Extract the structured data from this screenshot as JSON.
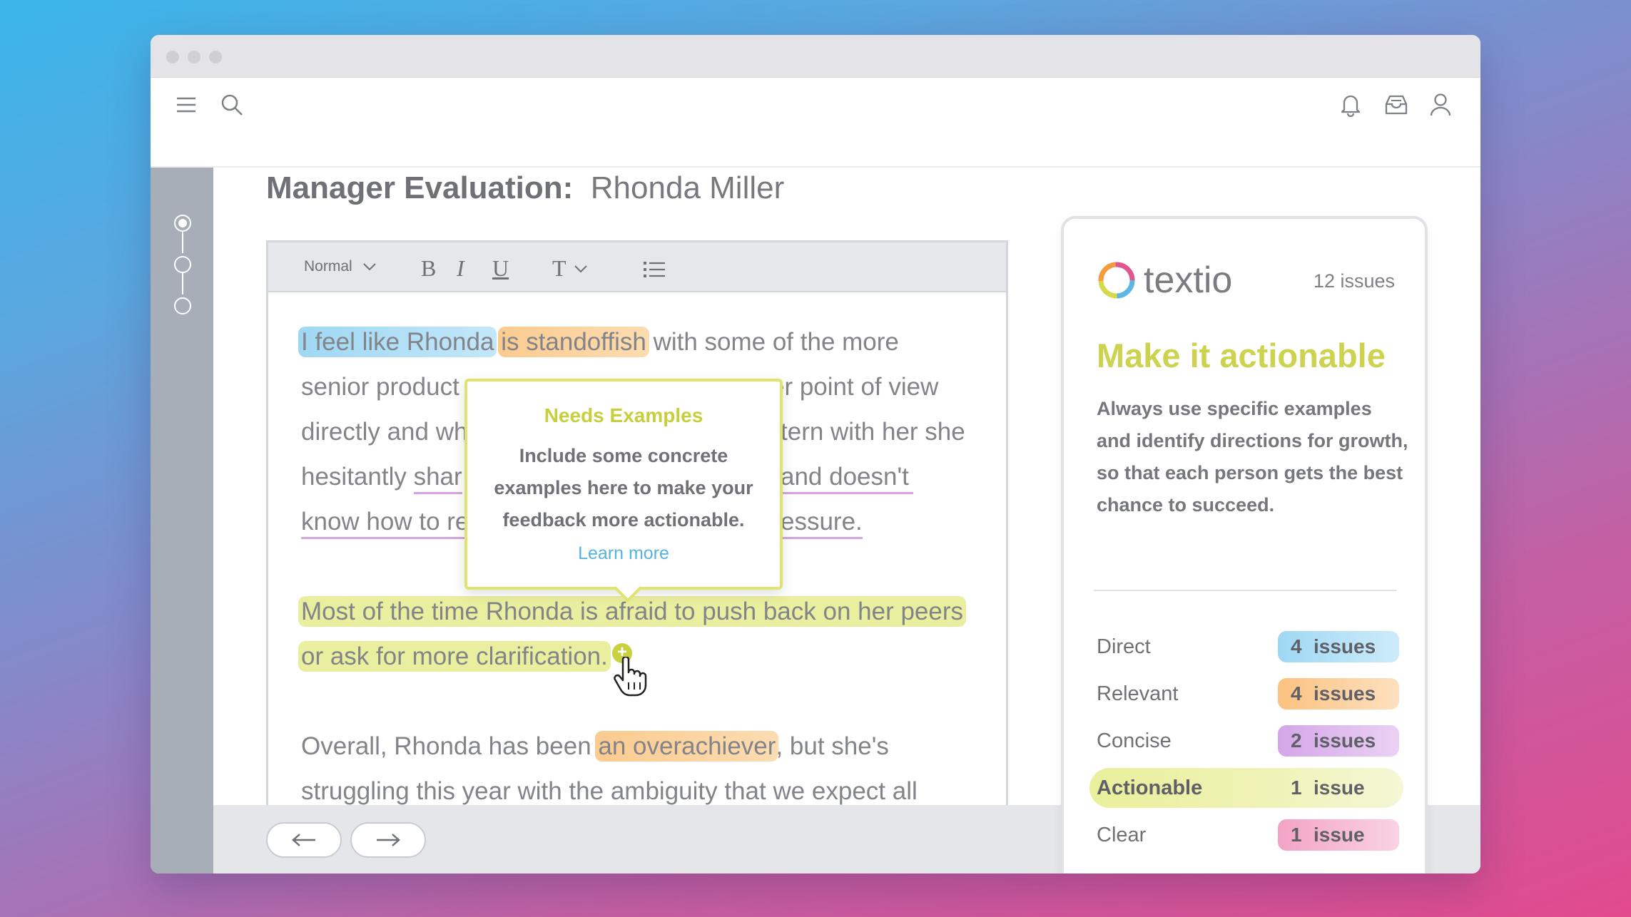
{
  "app": {
    "toolbar_icons": [
      "hamburger-menu-icon",
      "search-icon",
      "bell-icon",
      "inbox-icon",
      "user-icon"
    ]
  },
  "page": {
    "title_bold": "Manager Evaluation",
    "title_sep": ":",
    "title_name": "Rhonda Miller"
  },
  "editor": {
    "style_select": "Normal",
    "format_buttons": [
      "B",
      "I",
      "U",
      "T"
    ],
    "paragraph1": {
      "line1": {
        "hl_blue": "I feel like Rhonda",
        "hl_orange": "is standoffish",
        "rest": " with some of the more"
      },
      "line2": {
        "left": "senior product",
        "right": "er point of view"
      },
      "line3": {
        "left": "directly and wh",
        "right": "tern with her she"
      },
      "line4": {
        "left_plain": "hesitantly ",
        "left_ul": "shar",
        "right_ul": "and doesn't"
      },
      "line5": {
        "left_ul": "know how to re",
        "right_ul": "essure."
      }
    },
    "paragraph2": {
      "line1": "Most of the time Rhonda is afraid to push back on her peers",
      "line2": "or ask for more clarification."
    },
    "paragraph3": {
      "line1_a": "Overall, Rhonda has been ",
      "line1_hl": "an overachiever",
      "line1_b": ", but she's",
      "line2": "struggling this year with the ambiguity that we expect all"
    }
  },
  "tooltip": {
    "title": "Needs Examples",
    "body": "Include some concrete examples here to make your feedback more actionable.",
    "link": "Learn more"
  },
  "panel": {
    "brand": "textio",
    "issues_total": "12 issues",
    "headline": "Make it actionable",
    "description": "Always use specific examples and identify directions for growth, so that each person gets the best chance to succeed.",
    "categories": [
      {
        "name": "Direct",
        "count": "4",
        "word": "issues",
        "color": "#9fd8f4"
      },
      {
        "name": "Relevant",
        "count": "4",
        "word": "issues",
        "color": "#fbcb8f"
      },
      {
        "name": "Concise",
        "count": "2",
        "word": "issues",
        "color": "#d9b1ea"
      },
      {
        "name": "Actionable",
        "count": "1",
        "word": "issue",
        "color": "#eaef9b"
      },
      {
        "name": "Clear",
        "count": "1",
        "word": "issue",
        "color": "#f5b3cf"
      }
    ]
  },
  "footer": {
    "prev_icon": "arrow-left-icon",
    "next_icon": "arrow-right-icon"
  }
}
